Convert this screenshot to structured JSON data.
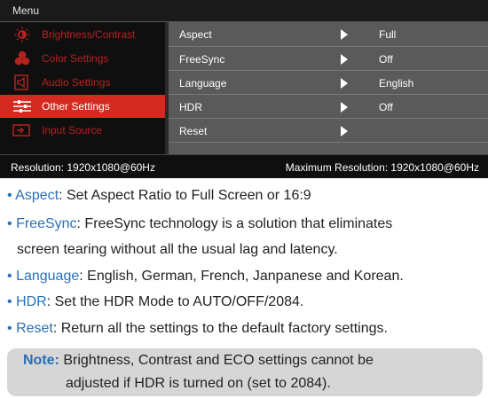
{
  "osd": {
    "title": "Menu",
    "left_menu": [
      {
        "label": "Brightness/Contrast",
        "icon": "brightness-icon",
        "active": false
      },
      {
        "label": "Color Settings",
        "icon": "color-settings-icon",
        "active": false
      },
      {
        "label": "Audio Settings",
        "icon": "audio-settings-icon",
        "active": false
      },
      {
        "label": "Other Settings",
        "icon": "other-settings-icon",
        "active": true
      },
      {
        "label": "Input Source",
        "icon": "input-source-icon",
        "active": false
      }
    ],
    "rows": [
      {
        "label": "Aspect",
        "value": "Full"
      },
      {
        "label": "FreeSync",
        "value": "Off"
      },
      {
        "label": "Language",
        "value": "English"
      },
      {
        "label": "HDR",
        "value": "Off"
      },
      {
        "label": "Reset",
        "value": ""
      }
    ],
    "status_left": "Resolution: 1920x1080@60Hz",
    "status_right": "Maximum Resolution: 1920x1080@60Hz",
    "colors": {
      "accent": "#d42a20",
      "dim_label": "#b3231f",
      "panel": "#5a5a5a",
      "menu_bg": "#0f0f0f"
    }
  },
  "descriptions": [
    {
      "term": "Aspect",
      "text": ": Set Aspect Ratio to Full Screen or 16:9"
    },
    {
      "term": "FreeSync",
      "text": ": FreeSync technology is a solution that eliminates",
      "text2": "screen tearing without all the usual lag and latency."
    },
    {
      "term": "Language",
      "text": ": English, German, French, Janpanese and Korean."
    },
    {
      "term": "HDR",
      "text": ": Set the HDR Mode to AUTO/OFF/2084."
    },
    {
      "term": "Reset",
      "text": ": Return all the settings to the default factory settings."
    }
  ],
  "bullet": "•",
  "note": {
    "label": "Note:",
    "line1": " Brightness, Contrast and ECO settings cannot be",
    "line2": "adjusted if HDR is turned on (set to 2084)."
  },
  "colors": {
    "keyword": "#2a6fb7",
    "note_bg": "#d6d6d6"
  }
}
